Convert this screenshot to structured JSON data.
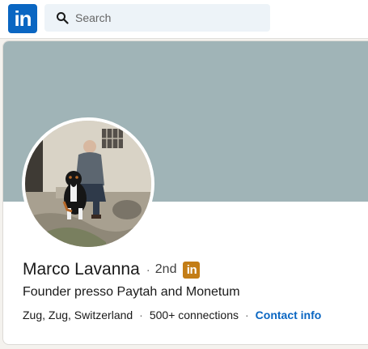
{
  "header": {
    "logo_text": "in",
    "search_placeholder": "Search"
  },
  "profile": {
    "name": "Marco Lavanna",
    "connection_degree": "2nd",
    "premium_badge_text": "in",
    "headline": "Founder presso Paytah and Monetum",
    "location": "Zug, Zug, Switzerland",
    "connections": "500+ connections",
    "contact_info_label": "Contact info",
    "separator": "·"
  },
  "colors": {
    "brand_blue": "#0a66c2",
    "cover": "#a0b4b7",
    "premium_gold": "#c37d16"
  },
  "icons": {
    "search": "search-icon",
    "logo": "linkedin-logo",
    "premium": "premium-badge-icon"
  }
}
